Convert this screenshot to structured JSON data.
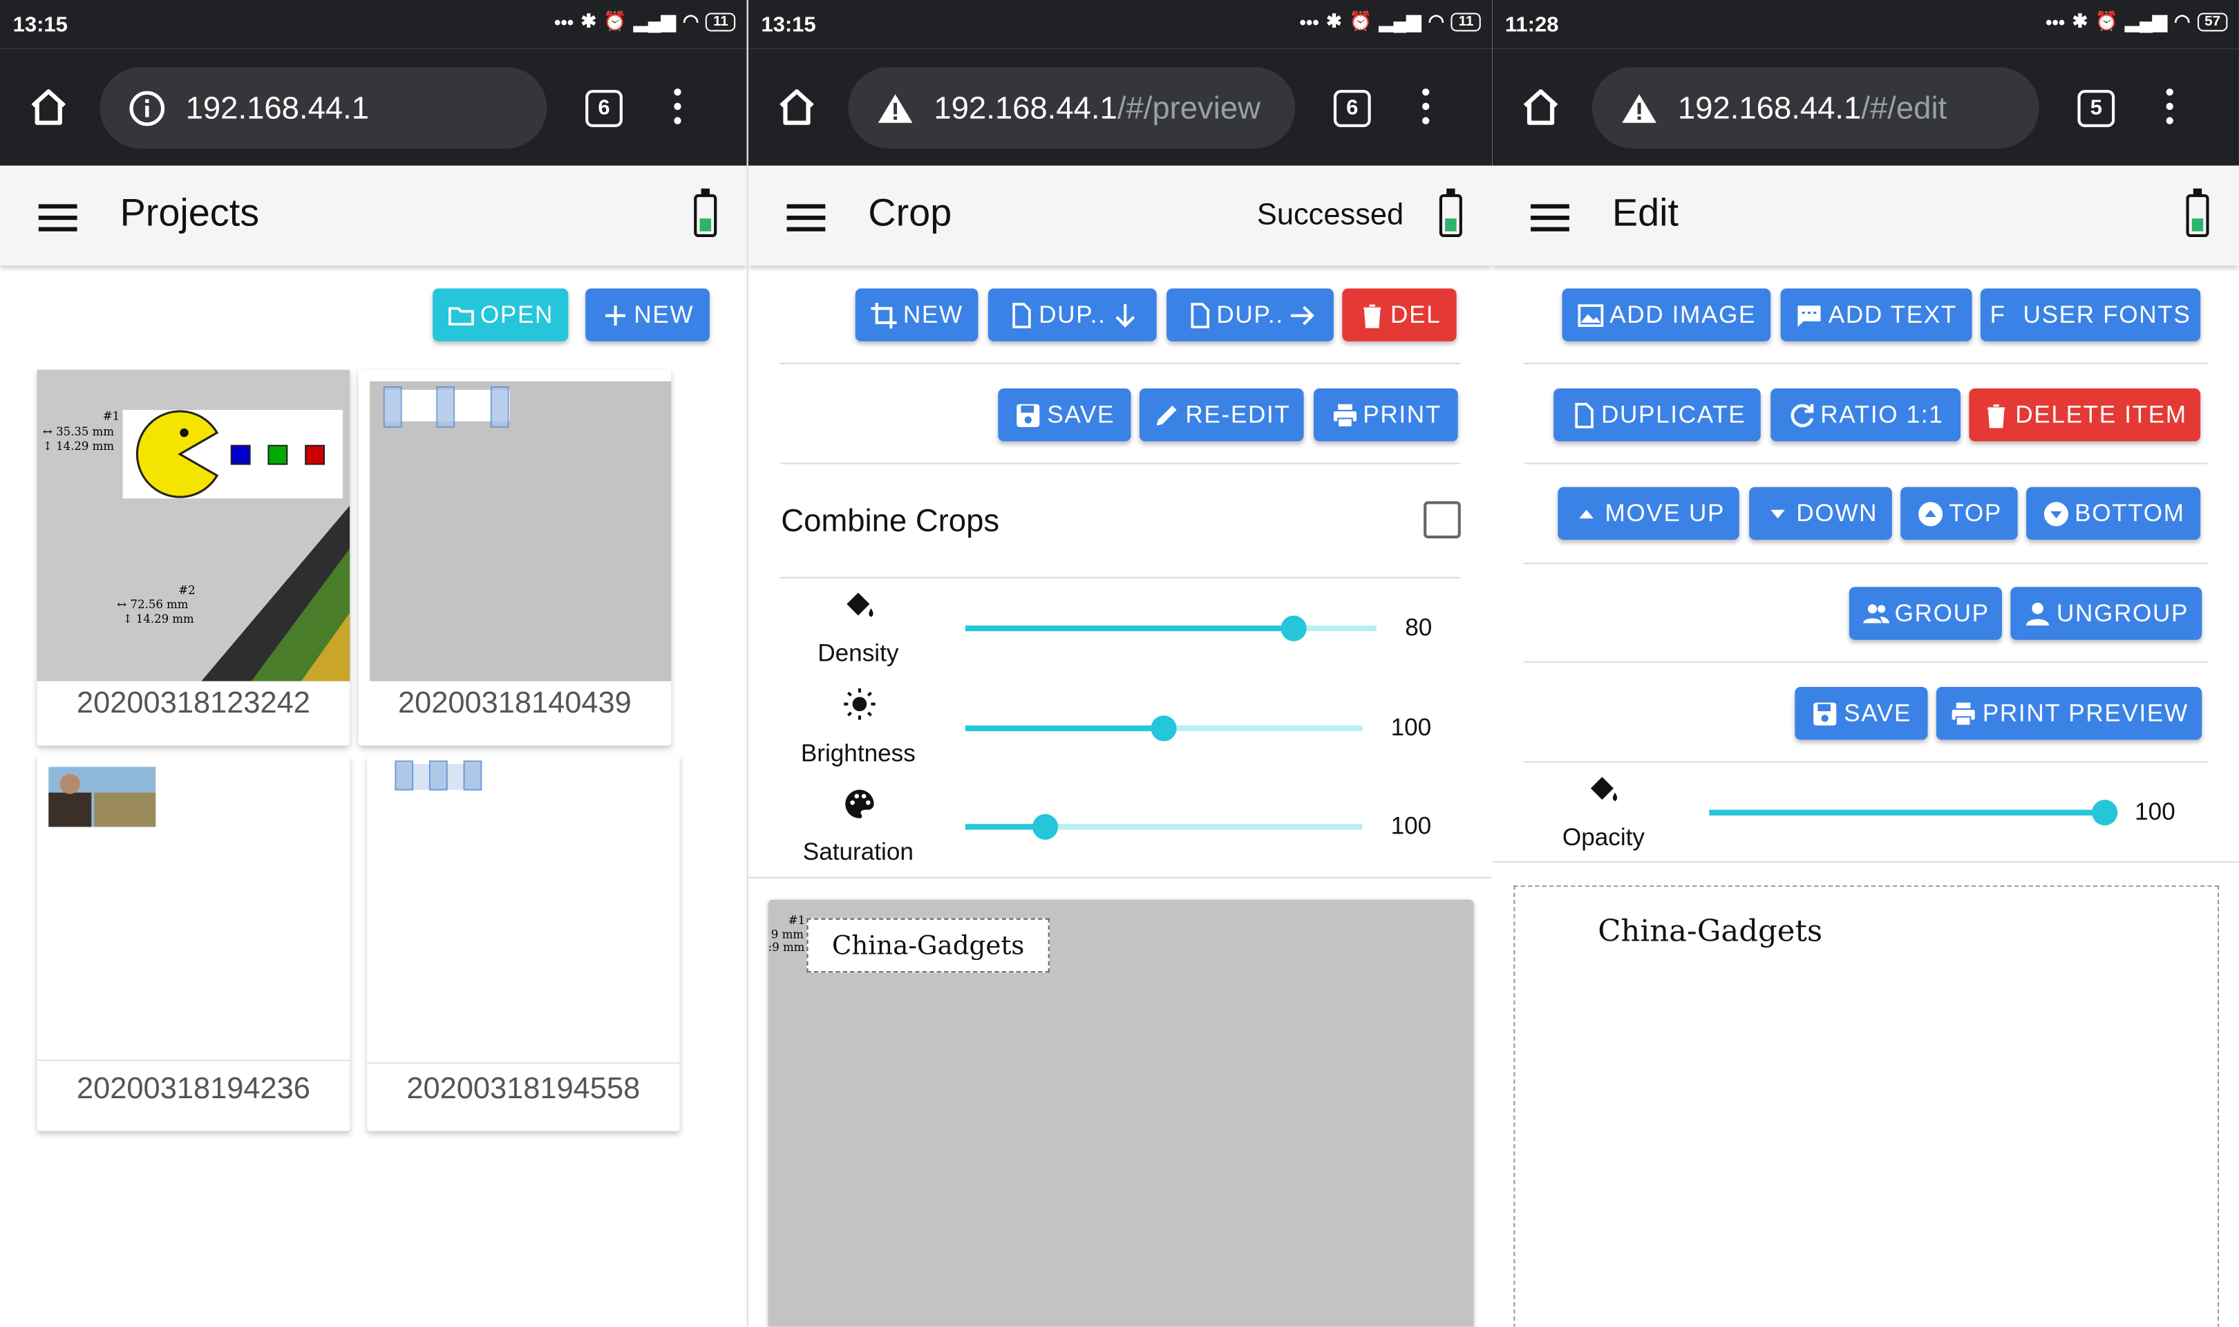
{
  "panels": {
    "projects": {
      "status_time": "13:15",
      "battery_level": "11",
      "url_host": "192.168.44.1",
      "url_path": "",
      "tab_count": "6",
      "title": "Projects",
      "open_label": "OPEN",
      "new_label": "NEW",
      "cards": [
        {
          "caption": "20200318123242"
        },
        {
          "caption": "20200318140439"
        },
        {
          "caption": "20200318194236"
        },
        {
          "caption": "20200318194558"
        }
      ],
      "thumb_text": {
        "pacman_id": "#1",
        "pacman_w": "↔ 35.35 mm",
        "pacman_h": "↕ 14.29 mm",
        "second_id": "#2",
        "second_w": "↔ 72.56 mm",
        "second_h": "↕ 14.29 mm"
      }
    },
    "crop": {
      "status_time": "13:15",
      "battery_level": "11",
      "url_host": "192.168.44.1",
      "url_path": "/#/preview",
      "tab_count": "6",
      "title": "Crop",
      "status_text": "Successed",
      "buttons": {
        "new": "NEW",
        "dup_down": "DUP..",
        "dup_right": "DUP..",
        "del": "DEL",
        "save": "SAVE",
        "reedit": "RE-EDIT",
        "print": "PRINT"
      },
      "combine_label": "Combine Crops",
      "combine_checked": false,
      "sliders": [
        {
          "label": "Density",
          "value": "80",
          "icon": "paint-bucket-icon",
          "fraction": 0.8
        },
        {
          "label": "Brightness",
          "value": "100",
          "icon": "sun-icon",
          "fraction": 0.5
        },
        {
          "label": "Saturation",
          "value": "100",
          "icon": "palette-icon",
          "fraction": 0.2
        }
      ],
      "preview_text": "China-Gadgets",
      "preview_marker": "#1",
      "preview_dim1": "9 mm",
      "preview_dim2": ":9 mm"
    },
    "edit": {
      "status_time": "11:28",
      "battery_level": "57",
      "url_host": "192.168.44.1",
      "url_path": "/#/edit",
      "tab_count": "5",
      "title": "Edit",
      "buttons": {
        "add_image": "ADD IMAGE",
        "add_text": "ADD TEXT",
        "user_fonts_prefix": "F",
        "user_fonts": "USER FONTS",
        "duplicate": "DUPLICATE",
        "ratio": "RATIO 1:1",
        "delete_item": "DELETE ITEM",
        "move_up": "MOVE UP",
        "down": "DOWN",
        "top": "TOP",
        "bottom": "BOTTOM",
        "group": "GROUP",
        "ungroup": "UNGROUP",
        "save": "SAVE",
        "print_preview": "PRINT PREVIEW"
      },
      "opacity_label": "Opacity",
      "opacity_value": "100",
      "opacity_fraction": 1.0,
      "canvas_text": "China-Gadgets"
    }
  },
  "colors": {
    "primary": "#3b82e6",
    "danger": "#e53935",
    "accent": "#26c6da",
    "browser_chrome": "#202124"
  }
}
